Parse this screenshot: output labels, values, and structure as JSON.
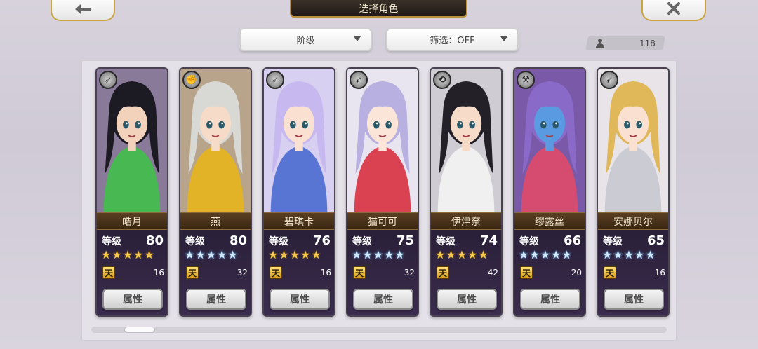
{
  "header": {
    "back_icon": "back-arrow-icon",
    "title": "选择角色",
    "close_icon": "close-x-icon"
  },
  "filters": {
    "rank_label": "阶级",
    "filter_label": "筛选：OFF"
  },
  "count": {
    "icon": "person-icon",
    "value": "118"
  },
  "level_label": "等级",
  "attr_label": "属性",
  "tian_label": "天",
  "characters": [
    {
      "name": "皓月",
      "level": "80",
      "stars": 5,
      "star_color": "#f4c84a",
      "tian": "16",
      "class_icon": "bow-icon",
      "hair": "#1c1a22",
      "skin": "#f3d2bc",
      "accent": "#3fbf4a",
      "bg": "#8a7a9a"
    },
    {
      "name": "燕",
      "level": "80",
      "stars": 5,
      "star_color": "#cfe8ff",
      "tian": "32",
      "class_icon": "fist-icon",
      "hair": "#d8d8d4",
      "skin": "#f6dcc8",
      "accent": "#e8b51c",
      "bg": "#b8a48a"
    },
    {
      "name": "碧琪卡",
      "level": "76",
      "stars": 5,
      "star_color": "#f4c84a",
      "tian": "16",
      "class_icon": "bow-icon",
      "hair": "#c8b8f0",
      "skin": "#f9e0d0",
      "accent": "#4a6ad0",
      "bg": "#d8d0f0"
    },
    {
      "name": "猫可可",
      "level": "75",
      "stars": 5,
      "star_color": "#cfe8ff",
      "tian": "32",
      "class_icon": "bow-icon",
      "hair": "#b8b0e0",
      "skin": "#fbe4d8",
      "accent": "#d83040",
      "bg": "#e8e4f0"
    },
    {
      "name": "伊津奈",
      "level": "74",
      "stars": 5,
      "star_color": "#f4c84a",
      "tian": "42",
      "class_icon": "whip-icon",
      "hair": "#242028",
      "skin": "#f6dcc8",
      "accent": "#f4f4f4",
      "bg": "#d0ccd4"
    },
    {
      "name": "缪露丝",
      "level": "66",
      "stars": 5,
      "star_color": "#cfe8ff",
      "tian": "20",
      "class_icon": "axe-icon",
      "hair": "#8a6ac8",
      "skin": "#5a9ae0",
      "accent": "#e04a6a",
      "bg": "#7a5aa8"
    },
    {
      "name": "安娜贝尔",
      "level": "65",
      "stars": 5,
      "star_color": "#cfe8ff",
      "tian": "16",
      "class_icon": "bow-icon",
      "hair": "#e0b85a",
      "skin": "#f9e0d0",
      "accent": "#c8c8d0",
      "bg": "#e8e4e8"
    }
  ],
  "scroll": {
    "position_fraction": 0.06
  }
}
